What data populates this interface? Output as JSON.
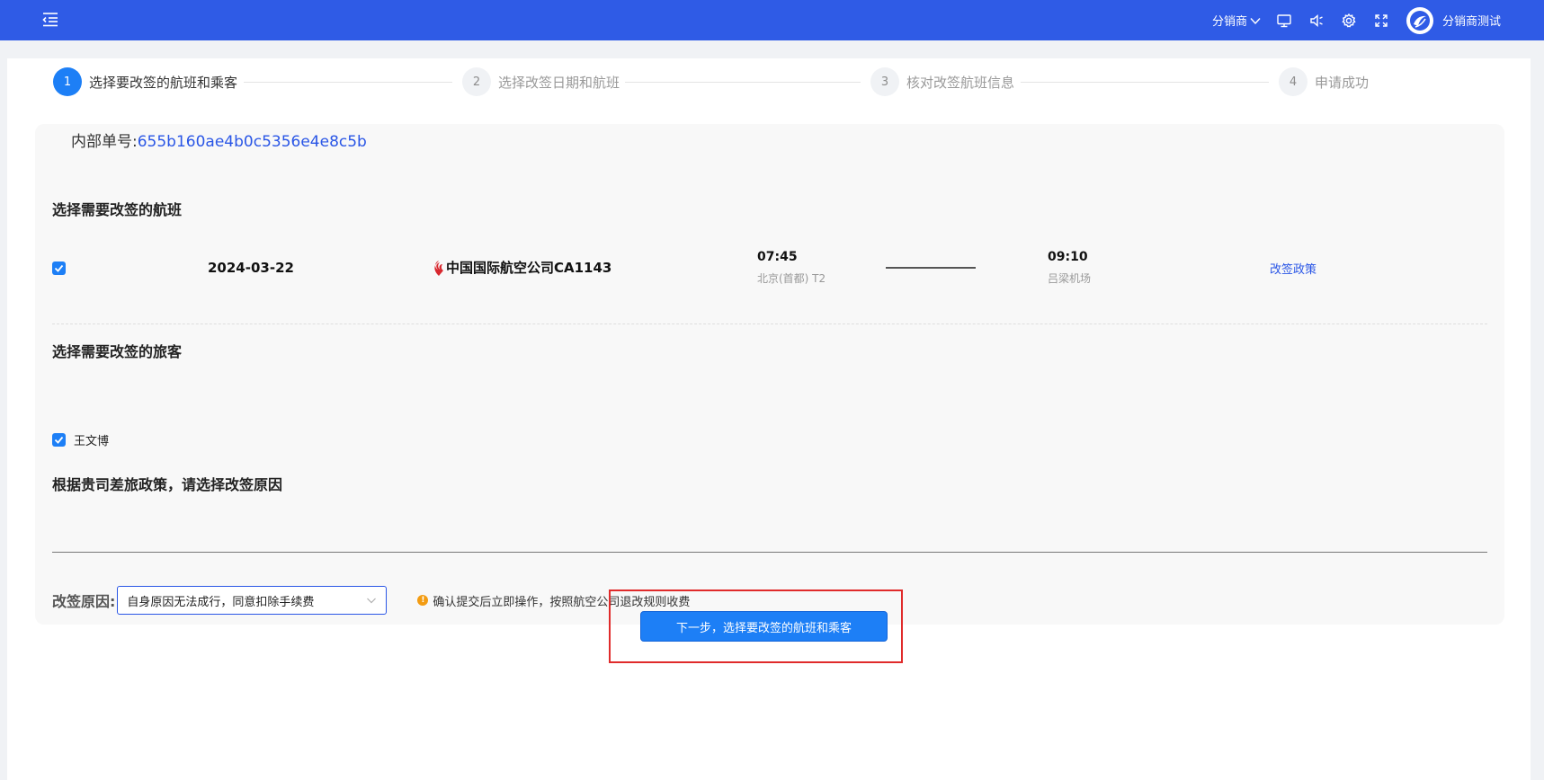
{
  "header": {
    "role_label": "分销商",
    "username": "分销商测试",
    "icons": [
      "menu-fold-icon",
      "monitor-icon",
      "speaker-icon",
      "gear-icon",
      "fullscreen-icon",
      "avatar-logo"
    ]
  },
  "steps": [
    {
      "num": "1",
      "label": "选择要改签的航班和乘客",
      "active": true
    },
    {
      "num": "2",
      "label": "选择改签日期和航班",
      "active": false
    },
    {
      "num": "3",
      "label": "核对改签航班信息",
      "active": false
    },
    {
      "num": "4",
      "label": "申请成功",
      "active": false
    }
  ],
  "order": {
    "label": "内部单号:",
    "value": "655b160ae4b0c5356e4e8c5b"
  },
  "flight_section": {
    "title": "选择需要改签的航班",
    "flight": {
      "checked": true,
      "date": "2024-03-22",
      "airline": "中国国际航空公司CA1143",
      "dep_time": "07:45",
      "dep_airport": "北京(首都) T2",
      "arr_time": "09:10",
      "arr_airport": "吕梁机场",
      "policy_link": "改签政策"
    }
  },
  "passenger_section": {
    "title": "选择需要改签的旅客",
    "passengers": [
      {
        "name": "王文博",
        "checked": true
      }
    ]
  },
  "reason_section": {
    "title": "根据贵司差旅政策，请选择改签原因",
    "label": "改签原因:",
    "selected": "自身原因无法成行，同意扣除手续费",
    "notice_mark": "!",
    "notice": "确认提交后立即操作，按照航空公司退改规则收费"
  },
  "next_button": "下一步，选择要改签的航班和乘客",
  "colors": {
    "header_bg": "#2f5be6",
    "primary": "#1d7ff6",
    "link": "#2a56e6",
    "highlight": "#e02b2b",
    "warning": "#f39c12"
  }
}
